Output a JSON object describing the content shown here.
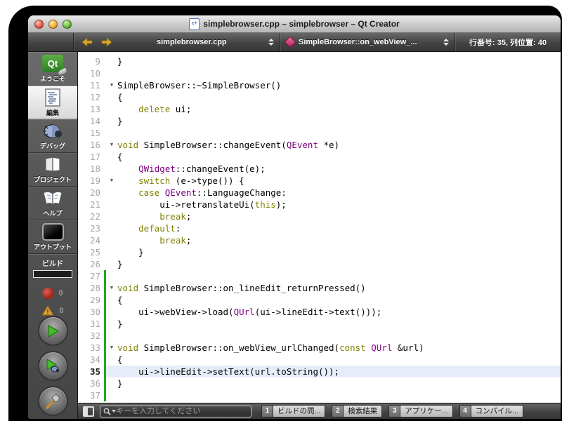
{
  "window": {
    "title": "simplebrowser.cpp – simplebrowser – Qt Creator",
    "doc_icon_text": "c+"
  },
  "toolbar": {
    "file_combo": "simplebrowser.cpp",
    "symbol_combo": "SimpleBrowser::on_webView_...",
    "line_info": "行番号: 35, 列位置: 40"
  },
  "sidebar": {
    "items": [
      {
        "label": "ようこそ",
        "icon": "qt-welcome",
        "logo_text": "Qt",
        "selected": false
      },
      {
        "label": "編集",
        "icon": "edit-document",
        "selected": true
      },
      {
        "label": "デバッグ",
        "icon": "debug-bug",
        "selected": false
      },
      {
        "label": "プロジェクト",
        "icon": "projects-folder",
        "selected": false
      },
      {
        "label": "ヘルプ",
        "icon": "help-book",
        "selected": false
      },
      {
        "label": "アウトプット",
        "icon": "output-screen",
        "selected": false
      }
    ],
    "build": {
      "label": "ビルド",
      "progress": 100
    },
    "errors": {
      "count": "0"
    },
    "warnings": {
      "count": "0",
      "glyph": "!"
    }
  },
  "editor": {
    "fold_glyph": "▼",
    "colors": {
      "keyword": "#808000",
      "type": "#800080",
      "change_bar": "#22a822",
      "current_line_bg": "#e6edf8"
    },
    "lines": [
      {
        "n": "9",
        "fold": false,
        "changed": false,
        "current": false,
        "seg": [
          [
            "}",
            ""
          ]
        ]
      },
      {
        "n": "10",
        "fold": false,
        "changed": false,
        "current": false,
        "seg": [
          [
            "",
            ""
          ]
        ]
      },
      {
        "n": "11",
        "fold": true,
        "changed": false,
        "current": false,
        "seg": [
          [
            "SimpleBrowser::~SimpleBrowser()",
            ""
          ]
        ]
      },
      {
        "n": "12",
        "fold": false,
        "changed": false,
        "current": false,
        "seg": [
          [
            "{",
            ""
          ]
        ]
      },
      {
        "n": "13",
        "fold": false,
        "changed": false,
        "current": false,
        "seg": [
          [
            "    ",
            ""
          ],
          [
            "delete",
            "k"
          ],
          [
            " ui;",
            ""
          ]
        ]
      },
      {
        "n": "14",
        "fold": false,
        "changed": false,
        "current": false,
        "seg": [
          [
            "}",
            ""
          ]
        ]
      },
      {
        "n": "15",
        "fold": false,
        "changed": false,
        "current": false,
        "seg": [
          [
            "",
            ""
          ]
        ]
      },
      {
        "n": "16",
        "fold": true,
        "changed": false,
        "current": false,
        "seg": [
          [
            "void",
            "k"
          ],
          [
            " SimpleBrowser::changeEvent(",
            ""
          ],
          [
            "QEvent",
            "t"
          ],
          [
            " *e)",
            ""
          ]
        ]
      },
      {
        "n": "17",
        "fold": false,
        "changed": false,
        "current": false,
        "seg": [
          [
            "{",
            ""
          ]
        ]
      },
      {
        "n": "18",
        "fold": false,
        "changed": false,
        "current": false,
        "seg": [
          [
            "    ",
            ""
          ],
          [
            "QWidget",
            "t"
          ],
          [
            "::changeEvent(e);",
            ""
          ]
        ]
      },
      {
        "n": "19",
        "fold": true,
        "changed": false,
        "current": false,
        "seg": [
          [
            "    ",
            ""
          ],
          [
            "switch",
            "k"
          ],
          [
            " (e->type()) {",
            ""
          ]
        ]
      },
      {
        "n": "20",
        "fold": false,
        "changed": false,
        "current": false,
        "seg": [
          [
            "    ",
            ""
          ],
          [
            "case",
            "k"
          ],
          [
            " ",
            ""
          ],
          [
            "QEvent",
            "t"
          ],
          [
            "::LanguageChange:",
            ""
          ]
        ]
      },
      {
        "n": "21",
        "fold": false,
        "changed": false,
        "current": false,
        "seg": [
          [
            "        ui->retranslateUi(",
            ""
          ],
          [
            "this",
            "k"
          ],
          [
            ");",
            ""
          ]
        ]
      },
      {
        "n": "22",
        "fold": false,
        "changed": false,
        "current": false,
        "seg": [
          [
            "        ",
            ""
          ],
          [
            "break",
            "k"
          ],
          [
            ";",
            ""
          ]
        ]
      },
      {
        "n": "23",
        "fold": false,
        "changed": false,
        "current": false,
        "seg": [
          [
            "    ",
            ""
          ],
          [
            "default",
            "k"
          ],
          [
            ":",
            ""
          ]
        ]
      },
      {
        "n": "24",
        "fold": false,
        "changed": false,
        "current": false,
        "seg": [
          [
            "        ",
            ""
          ],
          [
            "break",
            "k"
          ],
          [
            ";",
            ""
          ]
        ]
      },
      {
        "n": "25",
        "fold": false,
        "changed": false,
        "current": false,
        "seg": [
          [
            "    }",
            ""
          ]
        ]
      },
      {
        "n": "26",
        "fold": false,
        "changed": false,
        "current": false,
        "seg": [
          [
            "}",
            ""
          ]
        ]
      },
      {
        "n": "27",
        "fold": false,
        "changed": true,
        "current": false,
        "seg": [
          [
            "",
            ""
          ]
        ]
      },
      {
        "n": "28",
        "fold": true,
        "changed": true,
        "current": false,
        "seg": [
          [
            "void",
            "k"
          ],
          [
            " SimpleBrowser::on_lineEdit_returnPressed()",
            ""
          ]
        ]
      },
      {
        "n": "29",
        "fold": false,
        "changed": true,
        "current": false,
        "seg": [
          [
            "{",
            ""
          ]
        ]
      },
      {
        "n": "30",
        "fold": false,
        "changed": true,
        "current": false,
        "seg": [
          [
            "    ui->webView->load(",
            ""
          ],
          [
            "QUrl",
            "t"
          ],
          [
            "(ui->lineEdit->text()));",
            ""
          ]
        ]
      },
      {
        "n": "31",
        "fold": false,
        "changed": true,
        "current": false,
        "seg": [
          [
            "}",
            ""
          ]
        ]
      },
      {
        "n": "32",
        "fold": false,
        "changed": true,
        "current": false,
        "seg": [
          [
            "",
            ""
          ]
        ]
      },
      {
        "n": "33",
        "fold": true,
        "changed": true,
        "current": false,
        "seg": [
          [
            "void",
            "k"
          ],
          [
            " SimpleBrowser::on_webView_urlChanged(",
            ""
          ],
          [
            "const",
            "k"
          ],
          [
            " ",
            ""
          ],
          [
            "QUrl",
            "t"
          ],
          [
            " &url)",
            ""
          ]
        ]
      },
      {
        "n": "34",
        "fold": false,
        "changed": true,
        "current": false,
        "seg": [
          [
            "{",
            ""
          ]
        ]
      },
      {
        "n": "35",
        "fold": false,
        "changed": true,
        "current": true,
        "seg": [
          [
            "    ui->lineEdit->setText(url.toString());",
            ""
          ]
        ]
      },
      {
        "n": "36",
        "fold": false,
        "changed": true,
        "current": false,
        "seg": [
          [
            "}",
            ""
          ]
        ]
      },
      {
        "n": "37",
        "fold": false,
        "changed": true,
        "current": false,
        "seg": [
          [
            "",
            ""
          ]
        ]
      }
    ]
  },
  "bottombar": {
    "search_placeholder": "キーを入力してください",
    "panes": [
      {
        "num": "1",
        "label": "ビルドの問..."
      },
      {
        "num": "2",
        "label": "検索結果"
      },
      {
        "num": "3",
        "label": "アプリケー..."
      },
      {
        "num": "4",
        "label": "コンパイル..."
      }
    ]
  }
}
